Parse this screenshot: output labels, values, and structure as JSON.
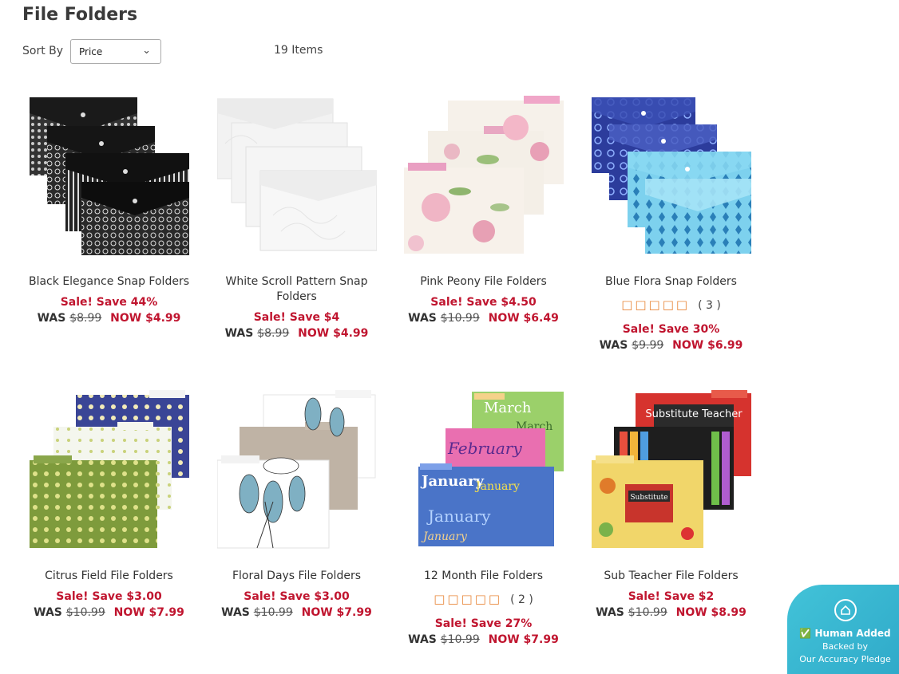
{
  "page": {
    "title": "File Folders",
    "item_count": "19 Items"
  },
  "sort": {
    "label": "Sort By",
    "selected": "Price"
  },
  "products": [
    {
      "name": "Black Elegance Snap Folders",
      "sale": "Sale! Save 44%",
      "was_label": "WAS",
      "was": "$8.99",
      "now": "NOW $4.99"
    },
    {
      "name": "White Scroll Pattern Snap Folders",
      "sale": "Sale! Save $4",
      "was_label": "WAS",
      "was": "$8.99",
      "now": "NOW $4.99"
    },
    {
      "name": "Pink Peony File Folders",
      "sale": "Sale! Save $4.50",
      "was_label": "WAS",
      "was": "$10.99",
      "now": "NOW $6.49"
    },
    {
      "name": "Blue Flora Snap Folders",
      "rating": {
        "stars": "□□□□□",
        "count": "( 3 )"
      },
      "sale": "Sale! Save 30%",
      "was_label": "WAS",
      "was": "$9.99",
      "now": "NOW $6.99"
    },
    {
      "name": "Citrus Field File Folders",
      "sale": "Sale! Save $3.00",
      "was_label": "WAS",
      "was": "$10.99",
      "now": "NOW $7.99"
    },
    {
      "name": "Floral Days File Folders",
      "sale": "Sale! Save $3.00",
      "was_label": "WAS",
      "was": "$10.99",
      "now": "NOW $7.99"
    },
    {
      "name": "12 Month File Folders",
      "rating": {
        "stars": "□□□□□",
        "count": "( 2 )"
      },
      "sale": "Sale! Save 27%",
      "was_label": "WAS",
      "was": "$10.99",
      "now": "NOW $7.99"
    },
    {
      "name": "Sub Teacher File Folders",
      "sale": "Sale! Save $2",
      "was_label": "WAS",
      "was": "$10.99",
      "now": "NOW $8.99"
    }
  ],
  "image_text": {
    "month_march": "March",
    "month_february": "February",
    "month_january": "January",
    "sub_title": "Substitute Teacher",
    "sub_sign": "Substitute"
  },
  "badge": {
    "title": "Human Added",
    "line1": "Backed by",
    "line2": "Our Accuracy Pledge",
    "icon": "home-shield-icon"
  },
  "colors": {
    "sale_red": "#c0152f",
    "badge_teal": "#42c3d8",
    "star_orange": "#e8873a"
  }
}
